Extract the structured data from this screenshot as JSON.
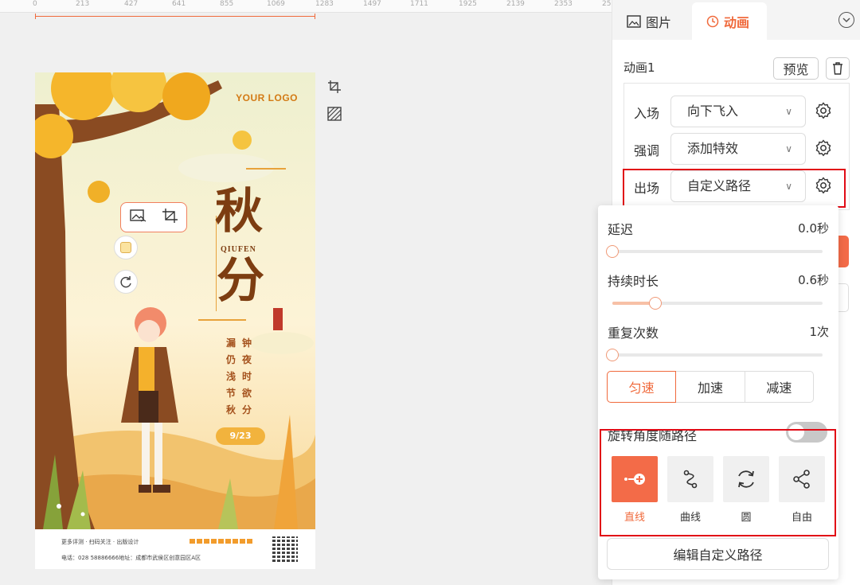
{
  "ruler": {
    "ticks": [
      "0",
      "213",
      "427",
      "641",
      "855",
      "1069",
      "1283",
      "1497",
      "1711",
      "1925",
      "2139",
      "2353",
      "25"
    ]
  },
  "poster": {
    "logo": "YOUR LOGO",
    "char1": "秋",
    "char2": "分",
    "pinyin": "QIUFEN",
    "col1": [
      "钟",
      "夜",
      "时",
      "欲",
      "分"
    ],
    "col2": [
      "漏",
      "仍",
      "浅",
      "节",
      "秋"
    ],
    "date": "9/23",
    "footer_line1": "更多评测 · 扫码关注 · 出版设计",
    "footer_line2": "电话：028 58886666地址：成都市武侯区创意园区A区"
  },
  "panel": {
    "tabs": [
      {
        "label": "图片",
        "icon": "image-icon"
      },
      {
        "label": "动画",
        "icon": "clock-icon"
      }
    ],
    "animation_title": "动画1",
    "preview_label": "预览",
    "rows": [
      {
        "label": "入场",
        "value": "向下飞入"
      },
      {
        "label": "强调",
        "value": "添加特效"
      },
      {
        "label": "出场",
        "value": "自定义路径"
      }
    ]
  },
  "popover": {
    "delay": {
      "label": "延迟",
      "value": "0.0秒",
      "fraction": 0.0
    },
    "duration": {
      "label": "持续时长",
      "value": "0.6秒",
      "fraction": 0.2
    },
    "repeat": {
      "label": "重复次数",
      "value": "1次",
      "fraction": 0.0
    },
    "speeds": [
      "匀速",
      "加速",
      "减速"
    ],
    "active_speed": "匀速",
    "rotate_label": "旋转角度随路径",
    "rotate_on": false,
    "paths": [
      {
        "label": "直线",
        "icon": "line-path-icon"
      },
      {
        "label": "曲线",
        "icon": "curve-path-icon"
      },
      {
        "label": "圆",
        "icon": "circle-path-icon"
      },
      {
        "label": "自由",
        "icon": "free-path-icon"
      }
    ],
    "active_path": "直线",
    "edit_button": "编辑自定义路径"
  },
  "colors": {
    "accent": "#f06a3c",
    "highlight_box": "#e10b16",
    "poster_brown": "#7d3d11"
  }
}
